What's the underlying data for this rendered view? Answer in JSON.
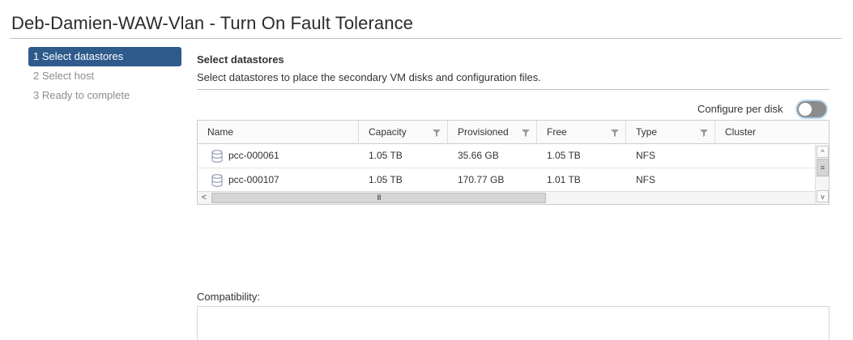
{
  "title": "Deb-Damien-WAW-Vlan - Turn On Fault Tolerance",
  "steps": [
    {
      "label": "1 Select datastores",
      "active": true
    },
    {
      "label": "2 Select host",
      "active": false
    },
    {
      "label": "3 Ready to complete",
      "active": false
    }
  ],
  "section": {
    "title": "Select datastores",
    "description": "Select datastores to place the secondary VM disks and configuration files."
  },
  "configure_per_disk": {
    "label": "Configure per disk",
    "enabled": false
  },
  "table": {
    "columns": [
      "Name",
      "Capacity",
      "Provisioned",
      "Free",
      "Type",
      "Cluster"
    ],
    "rows": [
      {
        "name": "pcc-000061",
        "capacity": "1.05 TB",
        "provisioned": "35.66 GB",
        "free": "1.05 TB",
        "type": "NFS",
        "cluster": ""
      },
      {
        "name": "pcc-000107",
        "capacity": "1.05 TB",
        "provisioned": "170.77 GB",
        "free": "1.01 TB",
        "type": "NFS",
        "cluster": ""
      }
    ]
  },
  "scroll_glyphs": {
    "up": "^",
    "down": "v",
    "left": "<",
    "grip_v": "≡",
    "grip_h": "III"
  },
  "compatibility": {
    "label": "Compatibility:"
  },
  "colors": {
    "accent": "#2e5b8c",
    "toggle_off": "#8c8c8c"
  },
  "icons": {
    "datastore": "database-icon",
    "filter": "filter-icon"
  }
}
